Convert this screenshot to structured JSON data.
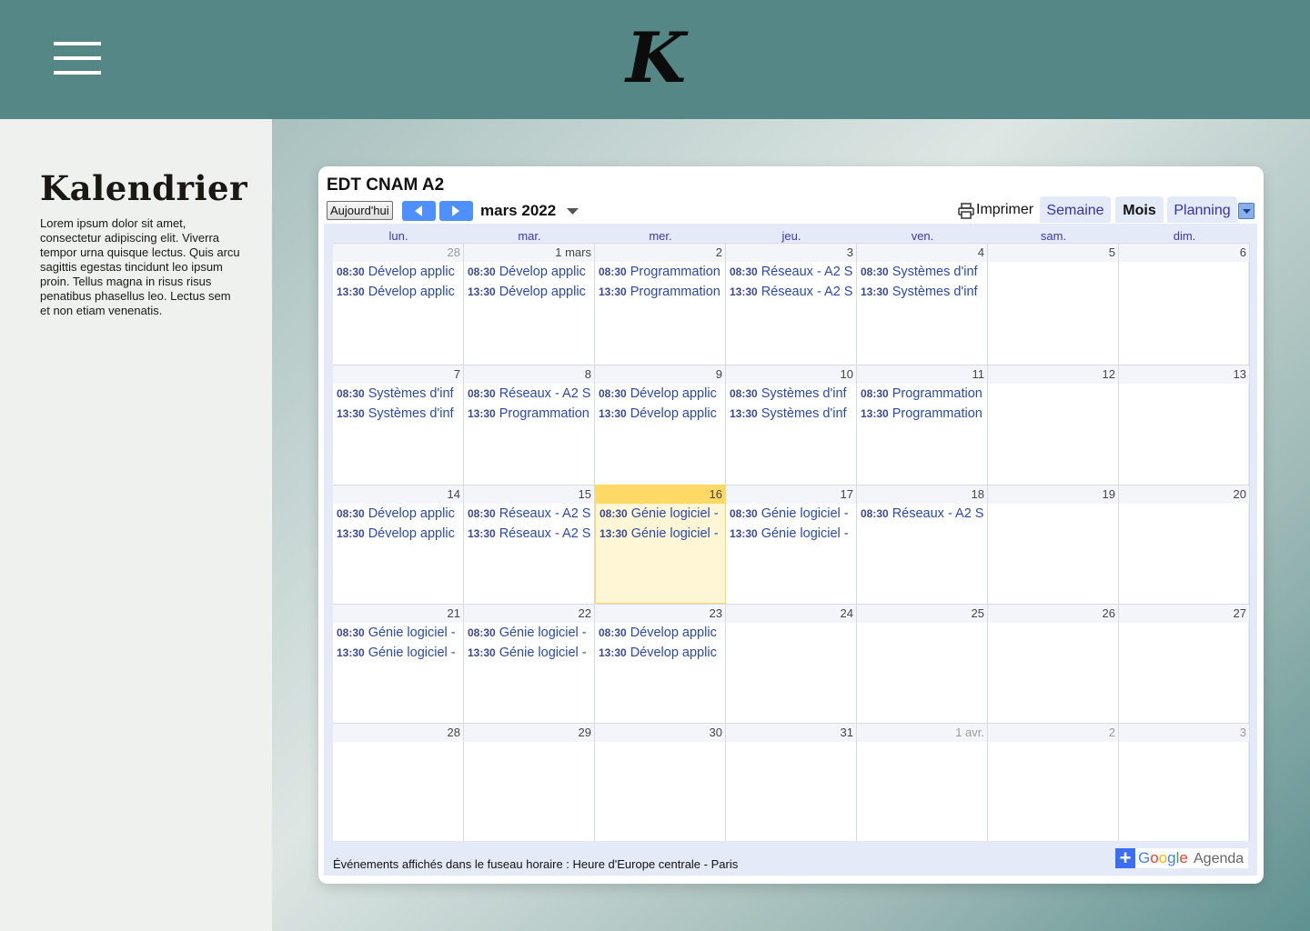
{
  "header": {
    "logo_letter": "K",
    "menu_icon": "hamburger-icon"
  },
  "sidebar": {
    "title": "Kalendrier",
    "description": "Lorem ipsum dolor sit amet, consectetur adipiscing elit. Viverra tempor urna quisque lectus. Quis arcu sagittis egestas tincidunt leo ipsum proin. Tellus magna in risus risus penatibus phasellus leo. Lectus sem et non etiam venenatis."
  },
  "calendar": {
    "title": "EDT CNAM A2",
    "today_label": "Aujourd'hui",
    "month_label": "mars 2022",
    "print_label": "Imprimer",
    "tabs": {
      "week": "Semaine",
      "month": "Mois",
      "agenda": "Planning"
    },
    "weekdays": [
      "lun.",
      "mar.",
      "mer.",
      "jeu.",
      "ven.",
      "sam.",
      "dim."
    ],
    "weeks": [
      [
        "28",
        "1 mars",
        "2",
        "3",
        "4",
        "5",
        "6"
      ],
      [
        "7",
        "8",
        "9",
        "10",
        "11",
        "12",
        "13"
      ],
      [
        "14",
        "15",
        "16",
        "17",
        "18",
        "19",
        "20"
      ],
      [
        "21",
        "22",
        "23",
        "24",
        "25",
        "26",
        "27"
      ],
      [
        "28",
        "29",
        "30",
        "31",
        "1 avr.",
        "2",
        "3"
      ]
    ],
    "event_times": [
      "08:30",
      "13:30"
    ],
    "events": {
      "develop": "Dévelop applic",
      "programmation": "Programmation",
      "reseaux": "Réseaux - A2 S",
      "systemes": "Systèmes d'inf",
      "genie": "Génie logiciel -"
    },
    "timezone_note": "Événements affichés dans le fuseau horaire : Heure d'Europe centrale - Paris",
    "badge": {
      "plus": "+",
      "google": "Google",
      "agenda": "Agenda"
    },
    "colors": {
      "today_bg": "#fff6d6",
      "today_head": "#ffd966",
      "event_text": "#2b4aa8",
      "nav_blue": "#4d90fe"
    }
  }
}
